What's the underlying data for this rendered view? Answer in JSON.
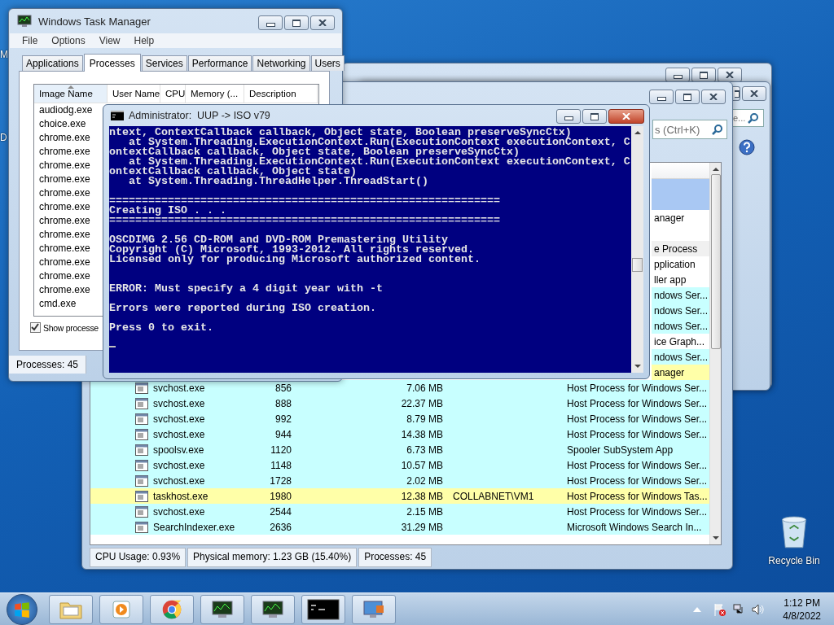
{
  "desktop": {
    "icon_labels": [
      "M",
      "D"
    ],
    "recycle_bin": {
      "label": "Recycle Bin"
    }
  },
  "back_windows": [
    {
      "kind": "plain"
    },
    {
      "kind": "search",
      "search_text": "e..."
    }
  ],
  "process_window": {
    "search": {
      "placeholder": "s (Ctrl+K)"
    },
    "rows": [
      {
        "kind": "partial",
        "selected": true
      },
      {
        "kind": "partial",
        "selected": true
      },
      {
        "kind": "partial",
        "selected": false,
        "color": "#ffffff",
        "description": "anager"
      },
      {
        "kind": "partial",
        "selected": false,
        "color": "#ffffff"
      },
      {
        "kind": "partial",
        "selected": false,
        "color": "#f0f0f0",
        "description": "e Process"
      },
      {
        "kind": "partial",
        "selected": false,
        "color": "#ffffff",
        "description": "pplication"
      },
      {
        "kind": "partial",
        "selected": false,
        "color": "#ffffff",
        "description": "ller app"
      },
      {
        "kind": "partial",
        "selected": false,
        "color": "#c8ffff",
        "description": "ndows Ser..."
      },
      {
        "kind": "partial",
        "selected": false,
        "color": "#c8ffff",
        "description": "ndows Ser..."
      },
      {
        "kind": "partial",
        "selected": false,
        "color": "#c8ffff",
        "description": "ndows Ser..."
      },
      {
        "kind": "partial",
        "selected": false,
        "color": "#ffffff",
        "description": "ice Graph..."
      },
      {
        "kind": "partial",
        "selected": false,
        "color": "#c8ffff",
        "description": "ndows Ser..."
      },
      {
        "kind": "partial",
        "selected": false,
        "color": "#ffffa8",
        "description": "anager"
      },
      {
        "kind": "process",
        "selected": false,
        "color": "#c8ffff",
        "name": "svchost.exe",
        "pid": "856",
        "memory": "7.06 MB",
        "description": "Host Process for Windows Ser..."
      },
      {
        "kind": "process",
        "selected": false,
        "color": "#c8ffff",
        "name": "svchost.exe",
        "pid": "888",
        "memory": "22.37 MB",
        "description": "Host Process for Windows Ser..."
      },
      {
        "kind": "process",
        "selected": false,
        "color": "#c8ffff",
        "name": "svchost.exe",
        "pid": "992",
        "memory": "8.79 MB",
        "description": "Host Process for Windows Ser..."
      },
      {
        "kind": "process",
        "selected": false,
        "color": "#c8ffff",
        "name": "svchost.exe",
        "pid": "944",
        "memory": "14.38 MB",
        "description": "Host Process for Windows Ser..."
      },
      {
        "kind": "process",
        "selected": false,
        "color": "#c8ffff",
        "name": "spoolsv.exe",
        "pid": "1120",
        "memory": "6.73 MB",
        "description": "Spooler SubSystem App"
      },
      {
        "kind": "process",
        "selected": false,
        "color": "#c8ffff",
        "name": "svchost.exe",
        "pid": "1148",
        "memory": "10.57 MB",
        "description": "Host Process for Windows Ser..."
      },
      {
        "kind": "process",
        "selected": false,
        "color": "#c8ffff",
        "name": "svchost.exe",
        "pid": "1728",
        "memory": "2.02 MB",
        "description": "Host Process for Windows Ser..."
      },
      {
        "kind": "process",
        "selected": false,
        "color": "#ffffa8",
        "name": "taskhost.exe",
        "pid": "1980",
        "memory": "12.38 MB",
        "user": "COLLABNET\\VM1",
        "description": "Host Process for Windows Tas..."
      },
      {
        "kind": "process",
        "selected": false,
        "color": "#c8ffff",
        "name": "svchost.exe",
        "pid": "2544",
        "memory": "2.15 MB",
        "description": "Host Process for Windows Ser..."
      },
      {
        "kind": "process",
        "selected": false,
        "color": "#c8ffff",
        "name": "SearchIndexer.exe",
        "pid": "2636",
        "memory": "31.29 MB",
        "description": "Microsoft Windows Search In..."
      }
    ],
    "status_bar": [
      "CPU Usage: 0.93%",
      "Physical memory: 1.23 GB (15.40%)",
      "Processes: 45"
    ]
  },
  "task_manager": {
    "title": "Windows Task Manager",
    "menu": [
      "File",
      "Options",
      "View",
      "Help"
    ],
    "tabs": [
      {
        "label": "Applications",
        "selected": false
      },
      {
        "label": "Processes",
        "selected": true
      },
      {
        "label": "Services",
        "selected": false
      },
      {
        "label": "Performance",
        "selected": false
      },
      {
        "label": "Networking",
        "selected": false
      },
      {
        "label": "Users",
        "selected": false
      }
    ],
    "columns": [
      {
        "label": "Image Name",
        "sorted": true
      },
      {
        "label": "User Name",
        "sorted": false
      },
      {
        "label": "CPU",
        "sorted": false
      },
      {
        "label": "Memory (...",
        "sorted": false
      },
      {
        "label": "Description",
        "sorted": false
      }
    ],
    "rows": [
      "audiodg.exe",
      "choice.exe",
      "chrome.exe",
      "chrome.exe",
      "chrome.exe",
      "chrome.exe",
      "chrome.exe",
      "chrome.exe",
      "chrome.exe",
      "chrome.exe",
      "chrome.exe",
      "chrome.exe",
      "chrome.exe",
      "chrome.exe",
      "cmd.exe"
    ],
    "show_all": {
      "label": "Show processe",
      "checked": true
    },
    "status_bar": "Processes: 45"
  },
  "console": {
    "title": "Administrator:  UUP -> ISO v79",
    "lines": [
      {
        "kind": "text",
        "text": "ntext, ContextCallback callback, Object state, Boolean preserveSyncCtx)"
      },
      {
        "kind": "text",
        "text": "   at System.Threading.ExecutionContext.Run(ExecutionContext executionContext, C"
      },
      {
        "kind": "text",
        "text": "ontextCallback callback, Object state, Boolean preserveSyncCtx)"
      },
      {
        "kind": "text",
        "text": "   at System.Threading.ExecutionContext.Run(ExecutionContext executionContext, C"
      },
      {
        "kind": "text",
        "text": "ontextCallback callback, Object state)"
      },
      {
        "kind": "text",
        "text": "   at System.Threading.ThreadHelper.ThreadStart()"
      },
      {
        "kind": "blank"
      },
      {
        "kind": "text",
        "text": "============================================================"
      },
      {
        "kind": "text",
        "text": "Creating ISO . . ."
      },
      {
        "kind": "text",
        "text": "============================================================"
      },
      {
        "kind": "blank"
      },
      {
        "kind": "text",
        "text": "OSCDIMG 2.56 CD-ROM and DVD-ROM Premastering Utility"
      },
      {
        "kind": "text",
        "text": "Copyright (C) Microsoft, 1993-2012. All rights reserved."
      },
      {
        "kind": "text",
        "text": "Licensed only for producing Microsoft authorized content."
      },
      {
        "kind": "blank"
      },
      {
        "kind": "blank"
      },
      {
        "kind": "text",
        "text": "ERROR: Must specify a 4 digit year with -t"
      },
      {
        "kind": "blank"
      },
      {
        "kind": "text",
        "text": "Errors were reported during ISO creation."
      },
      {
        "kind": "blank"
      },
      {
        "kind": "text",
        "text": "Press 0 to exit."
      },
      {
        "kind": "blank"
      },
      {
        "kind": "cursor"
      }
    ]
  },
  "taskbar": {
    "buttons": [
      {
        "kind": "folder"
      },
      {
        "kind": "media"
      },
      {
        "kind": "browser"
      },
      {
        "kind": "monitor"
      },
      {
        "kind": "monitor"
      },
      {
        "kind": "console"
      },
      {
        "kind": "remote"
      }
    ],
    "clock": {
      "time": "1:12 PM",
      "date": "4/8/2022"
    }
  }
}
